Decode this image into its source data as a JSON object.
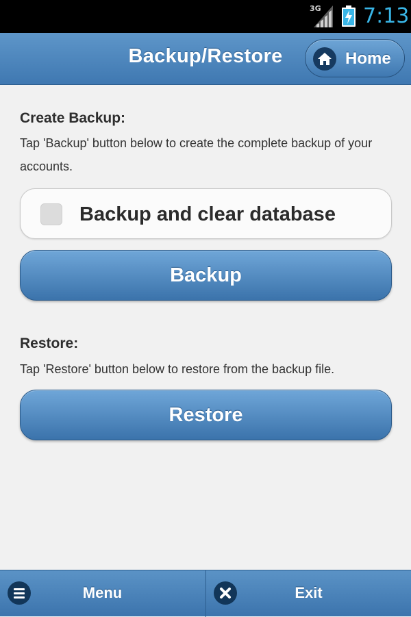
{
  "status_bar": {
    "network_type": "3G",
    "time": "7:13",
    "accent_color": "#39b5e6"
  },
  "header": {
    "title": "Backup/Restore",
    "home_button": {
      "label": "Home",
      "icon": "home-icon"
    }
  },
  "backup_section": {
    "title": "Create Backup:",
    "description": "Tap 'Backup' button below to create the complete backup of your accounts.",
    "checkbox": {
      "label": "Backup and clear database",
      "checked": false
    },
    "button_label": "Backup"
  },
  "restore_section": {
    "title": "Restore:",
    "description": "Tap 'Restore' button below to restore from the backup file.",
    "button_label": "Restore"
  },
  "footer": {
    "tabs": [
      {
        "label": "Menu",
        "icon": "menu-icon"
      },
      {
        "label": "Exit",
        "icon": "close-icon"
      }
    ]
  },
  "colors": {
    "bar_blue": "#4a83bb",
    "button_blue": "#5592c9",
    "background": "#f1f1f1"
  }
}
